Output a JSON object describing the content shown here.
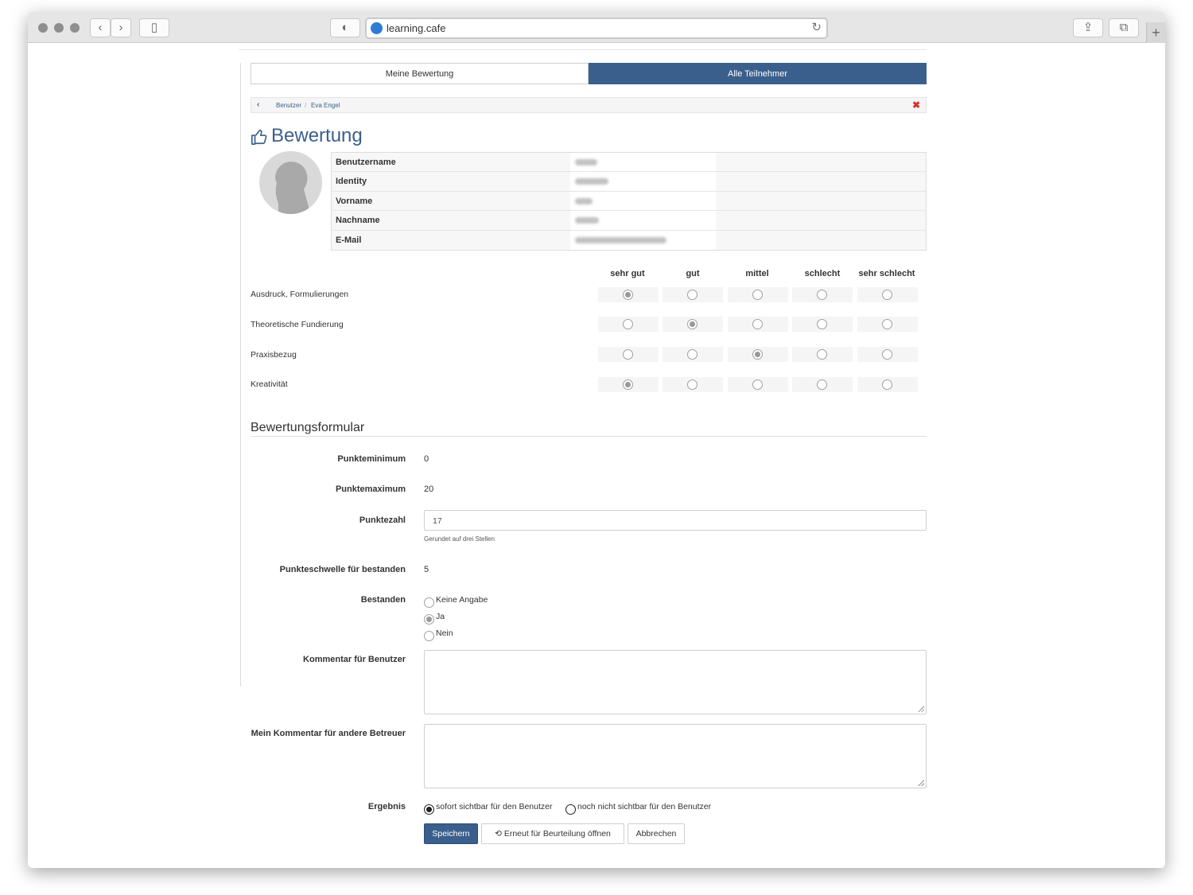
{
  "browser": {
    "url": "learning.cafe"
  },
  "tabs": [
    "Meine Bewertung",
    "Alle Teilnehmer"
  ],
  "breadcrumb": {
    "items": [
      "Benutzer",
      "Eva Engel"
    ]
  },
  "page_title": "Bewertung",
  "user_info": {
    "labels": [
      "Benutzername",
      "Identity",
      "Vorname",
      "Nachname",
      "E-Mail"
    ]
  },
  "rating": {
    "columns": [
      "sehr gut",
      "gut",
      "mittel",
      "schlecht",
      "sehr schlecht"
    ],
    "criteria": [
      "Ausdruck, Formulierungen",
      "Theoretische Fundierung",
      "Praxisbezug",
      "Kreativität"
    ],
    "selected": [
      0,
      1,
      2,
      0
    ]
  },
  "form": {
    "section_title": "Bewertungsformular",
    "min_label": "Punkteminimum",
    "min_value": "0",
    "max_label": "Punktemaximum",
    "max_value": "20",
    "score_label": "Punktezahl",
    "score_value": "17",
    "score_hint": "Gerundet auf drei Stellen",
    "threshold_label": "Punkteschwelle für bestanden",
    "threshold_value": "5",
    "passed_label": "Bestanden",
    "passed_options": [
      "Keine Angabe",
      "Ja",
      "Nein"
    ],
    "passed_selected": 1,
    "comment_user_label": "Kommentar für Benutzer",
    "comment_other_label": "Mein Kommentar für andere Betreuer",
    "result_label": "Ergebnis",
    "result_options": [
      "sofort sichtbar für den Benutzer",
      "noch nicht sichtbar für den Benutzer"
    ],
    "result_selected": 0
  },
  "buttons": {
    "save": "Speichern",
    "reopen": "Erneut für Beurteilung öffnen",
    "cancel": "Abbrechen"
  }
}
